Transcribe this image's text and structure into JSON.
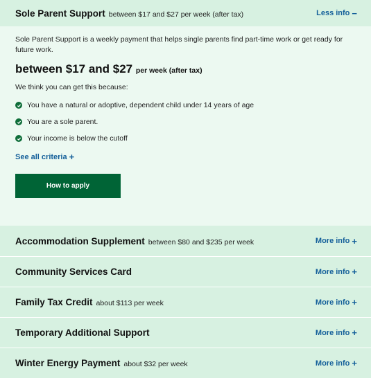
{
  "open_panel": {
    "title": "Sole Parent Support",
    "subtitle": "between $17 and $27 per week (after tax)",
    "toggle_label": "Less info",
    "toggle_symbol": "−",
    "description": "Sole Parent Support is a weekly payment that helps single parents find part-time work or get ready for future work.",
    "amount_main": "between $17 and $27",
    "amount_suffix": "per week (after tax)",
    "lead": "We think you can get this because:",
    "criteria": [
      "You have a natural or adoptive, dependent child under 14 years of age",
      "You are a sole parent.",
      "Your income is below the cutoff"
    ],
    "see_all_label": "See all criteria",
    "see_all_symbol": "+",
    "apply_label": "How to apply"
  },
  "items": [
    {
      "title": "Accommodation Supplement",
      "subtitle": "between $80 and $235 per week",
      "toggle_label": "More info",
      "toggle_symbol": "+"
    },
    {
      "title": "Community Services Card",
      "subtitle": "",
      "toggle_label": "More info",
      "toggle_symbol": "+"
    },
    {
      "title": "Family Tax Credit",
      "subtitle": "about $113 per week",
      "toggle_label": "More info",
      "toggle_symbol": "+"
    },
    {
      "title": "Temporary Additional Support",
      "subtitle": "",
      "toggle_label": "More info",
      "toggle_symbol": "+"
    },
    {
      "title": "Winter Energy Payment",
      "subtitle": "about $32 per week",
      "toggle_label": "More info",
      "toggle_symbol": "+"
    }
  ],
  "colors": {
    "header_bg": "#d7f1e1",
    "body_bg": "#ecf9f1",
    "link": "#15609a",
    "button_bg": "#006436",
    "check": "#0f6e3a"
  }
}
